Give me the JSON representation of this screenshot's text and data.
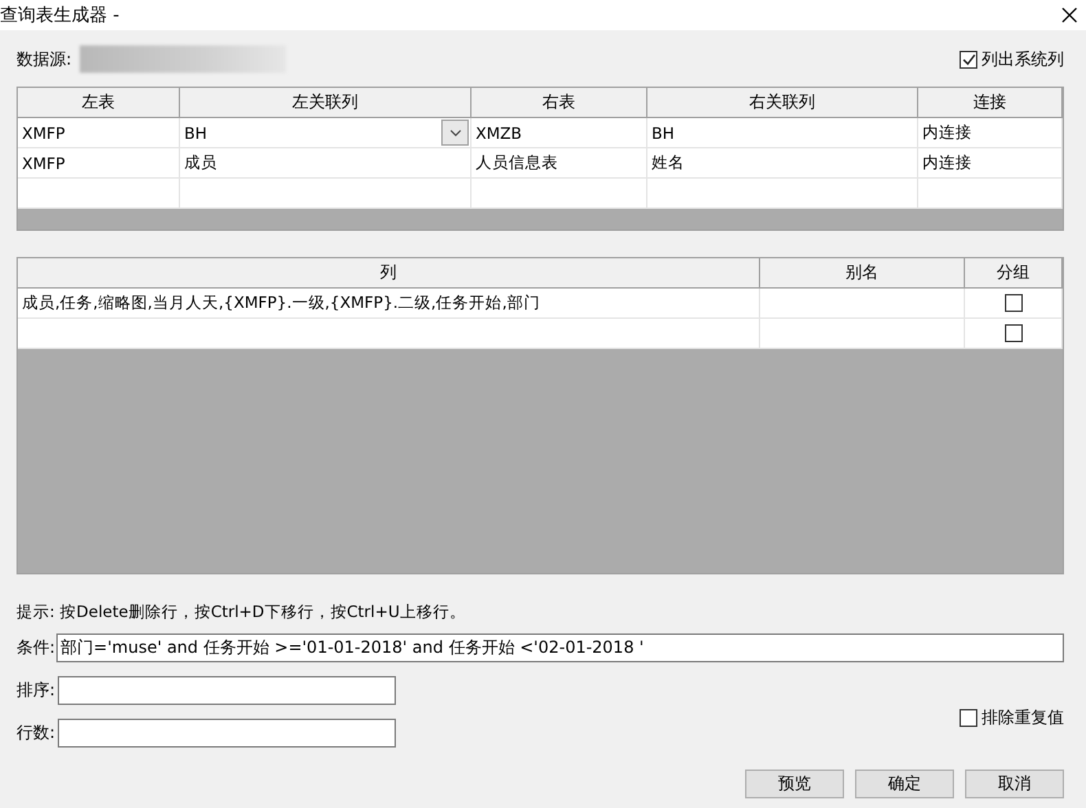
{
  "window": {
    "title": "查询表生成器 -"
  },
  "datasource": {
    "label": "数据源:"
  },
  "list_system_columns": {
    "label": "列出系统列",
    "checked": true
  },
  "joins": {
    "columns": [
      "左表",
      "左关联列",
      "右表",
      "右关联列",
      "连接"
    ],
    "rows": [
      {
        "cells": [
          "XMFP",
          "BH",
          "XMZB",
          "BH",
          "内连接"
        ],
        "dropdown": true
      },
      {
        "cells": [
          "XMFP",
          "成员",
          "人员信息表",
          "姓名",
          "内连接"
        ],
        "dropdown": false
      },
      {
        "cells": [
          "",
          "",
          "",
          "",
          ""
        ],
        "dropdown": false
      }
    ]
  },
  "columns_table": {
    "columns": [
      "列",
      "别名",
      "分组"
    ],
    "rows": [
      {
        "column": "成员,任务,缩略图,当月人天,{XMFP}.一级,{XMFP}.二级,任务开始,部门",
        "alias": "",
        "group": false
      },
      {
        "column": "",
        "alias": "",
        "group": false
      }
    ]
  },
  "hint": "提示: 按Delete删除行，按Ctrl+D下移行，按Ctrl+U上移行。",
  "condition": {
    "label": "条件:",
    "value": "部门='muse' and 任务开始 >='01-01-2018' and 任务开始 <'02-01-2018 '"
  },
  "sort": {
    "label": "排序:"
  },
  "row_count": {
    "label": "行数:"
  },
  "distinct": {
    "label": "排除重复值",
    "checked": false
  },
  "buttons": [
    "预览",
    "确定",
    "取消"
  ]
}
